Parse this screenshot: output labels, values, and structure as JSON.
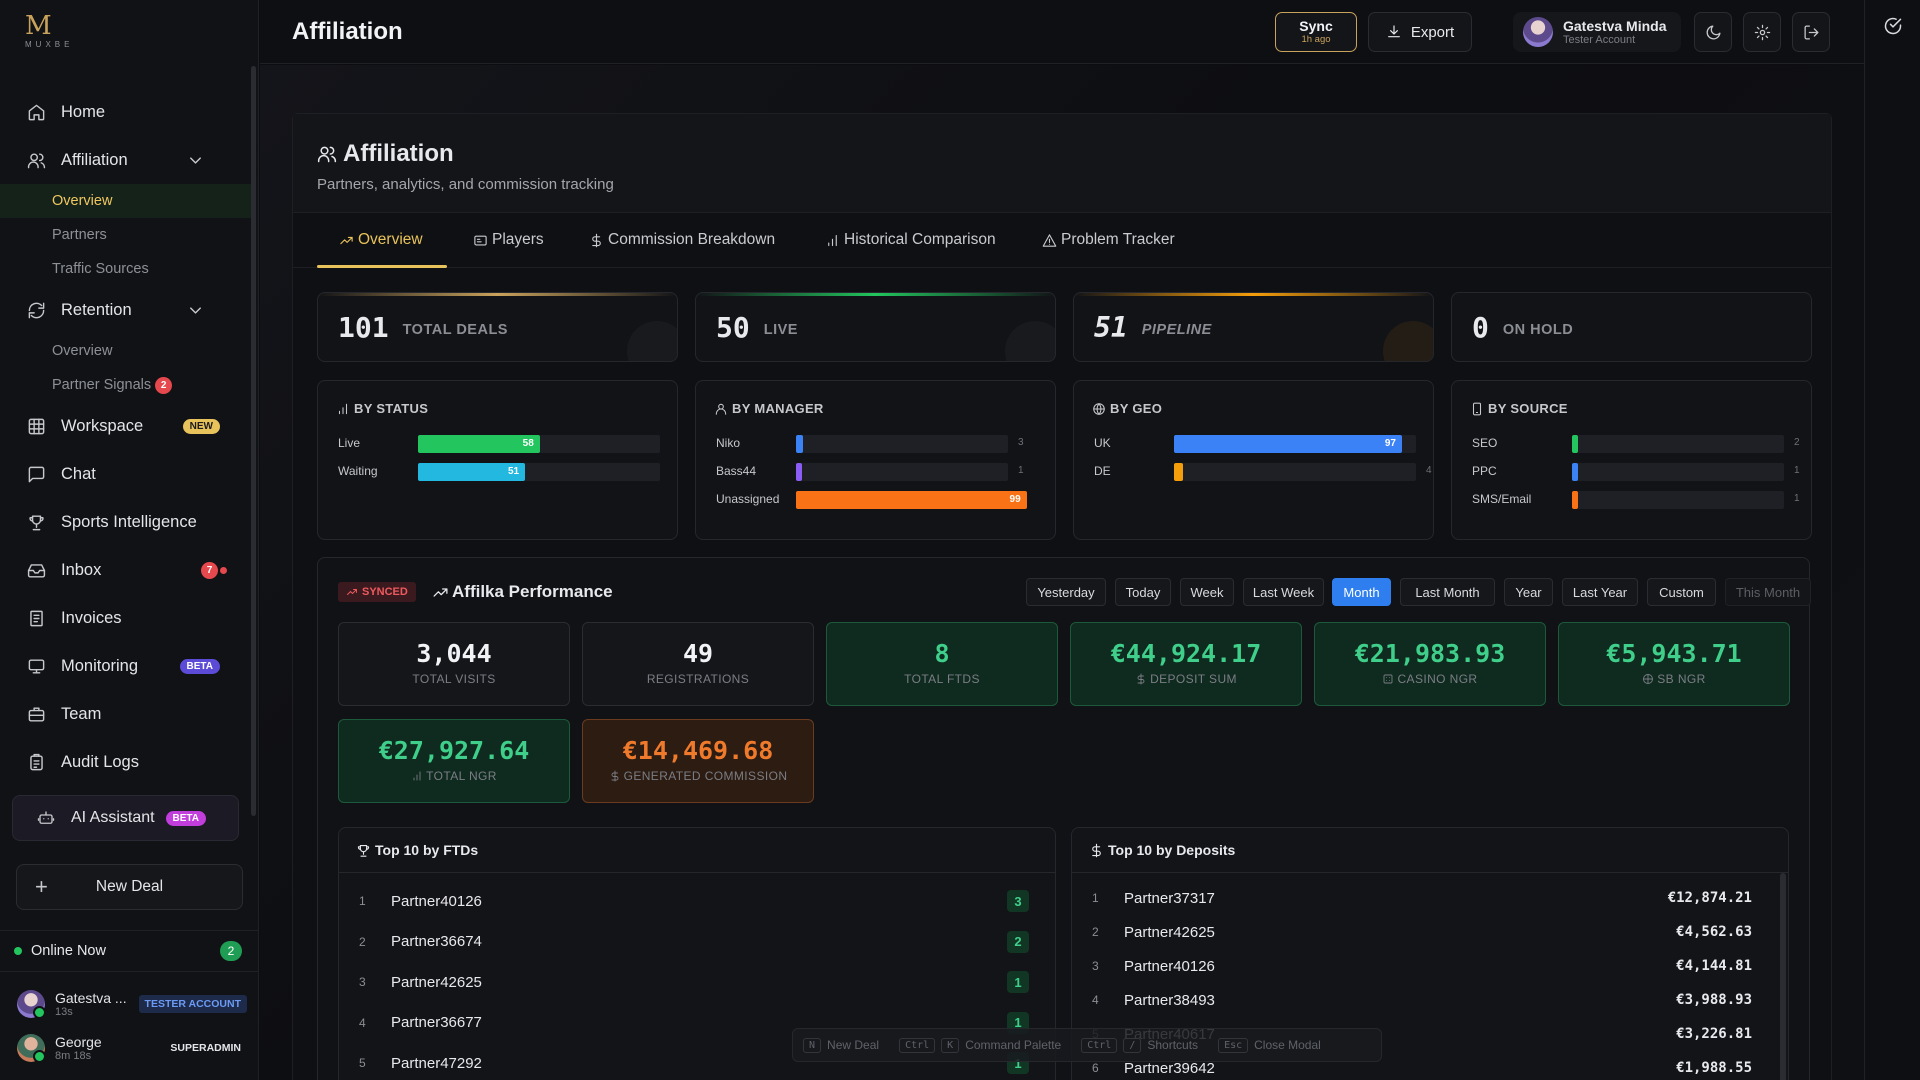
{
  "brand": {
    "mark": "M",
    "wordmark": "MUXBE"
  },
  "nav": {
    "home": "Home",
    "affiliation": "Affiliation",
    "affiliation_sub": [
      "Overview",
      "Partners",
      "Traffic Sources"
    ],
    "retention": "Retention",
    "retention_sub": [
      "Overview",
      "Partner Signals"
    ],
    "partner_signals_badge": "2",
    "workspace": "Workspace",
    "workspace_badge": "NEW",
    "chat": "Chat",
    "sports": "Sports Intelligence",
    "inbox": "Inbox",
    "inbox_badge": "7",
    "invoices": "Invoices",
    "monitoring": "Monitoring",
    "monitoring_badge": "BETA",
    "team": "Team",
    "audit": "Audit Logs",
    "ai": "AI Assistant",
    "ai_badge": "BETA",
    "new_deal": "New Deal"
  },
  "online": {
    "label": "Online Now",
    "count": "2",
    "users": [
      {
        "name": "Gatestva ...",
        "time": "13s",
        "role": "TESTER ACCOUNT"
      },
      {
        "name": "George",
        "time": "8m 18s",
        "role": "SUPERADMIN"
      }
    ]
  },
  "topbar": {
    "title": "Affiliation",
    "sync_label": "Sync",
    "sync_time": "1h ago",
    "export_label": "Export",
    "user_name": "Gatestva Minda",
    "user_role": "Tester Account"
  },
  "header": {
    "title": "Affiliation",
    "subtitle": "Partners, analytics, and commission tracking"
  },
  "tabs": [
    "Overview",
    "Players",
    "Commission Breakdown",
    "Historical Comparison",
    "Problem Tracker"
  ],
  "stats": [
    {
      "value": "101",
      "label": "TOTAL DEALS",
      "color": "#c9a25c"
    },
    {
      "value": "50",
      "label": "LIVE",
      "color": "#22c55e"
    },
    {
      "value": "51",
      "label": "PIPELINE",
      "color": "#f59e0b"
    },
    {
      "value": "0",
      "label": "ON HOLD",
      "color": "#2a2c31"
    }
  ],
  "by_status": {
    "title": "BY STATUS",
    "rows": [
      {
        "label": "Live",
        "value": 58,
        "max": 100,
        "color": "#22c55e"
      },
      {
        "label": "Waiting",
        "value": 51,
        "max": 100,
        "color": "#22b8e0"
      }
    ]
  },
  "by_manager": {
    "title": "BY MANAGER",
    "rows": [
      {
        "label": "Niko",
        "value": 3,
        "max": 100,
        "color": "#3b82f6"
      },
      {
        "label": "Bass44",
        "value": 1,
        "max": 100,
        "color": "#8b5cf6"
      },
      {
        "label": "Unassigned",
        "value": 99,
        "max": 100,
        "color": "#f97316"
      }
    ]
  },
  "by_geo": {
    "title": "BY GEO",
    "rows": [
      {
        "label": "UK",
        "value": 97,
        "max": 100,
        "color": "#3b82f6"
      },
      {
        "label": "DE",
        "value": 4,
        "max": 100,
        "color": "#f59e0b"
      }
    ]
  },
  "by_source": {
    "title": "BY SOURCE",
    "rows": [
      {
        "label": "SEO",
        "value": 2,
        "max": 100,
        "color": "#22c55e"
      },
      {
        "label": "PPC",
        "value": 1,
        "max": 100,
        "color": "#3b82f6"
      },
      {
        "label": "SMS/Email",
        "value": 1,
        "max": 100,
        "color": "#f97316"
      }
    ]
  },
  "performance": {
    "synced": "SYNCED",
    "title": "Affilka Performance",
    "filters": [
      "Yesterday",
      "Today",
      "Week",
      "Last Week",
      "Month",
      "Last Month",
      "Year",
      "Last Year",
      "Custom",
      "This Month"
    ],
    "active_filter": "Month",
    "metrics": [
      {
        "value": "3,044",
        "label": "TOTAL VISITS"
      },
      {
        "value": "49",
        "label": "REGISTRATIONS"
      },
      {
        "value": "8",
        "label": "TOTAL FTDS"
      },
      {
        "value": "€44,924.17",
        "label": "DEPOSIT SUM"
      },
      {
        "value": "€21,983.93",
        "label": "CASINO NGR"
      },
      {
        "value": "€5,943.71",
        "label": "SB NGR"
      },
      {
        "value": "€27,927.64",
        "label": "TOTAL NGR"
      },
      {
        "value": "€14,469.68",
        "label": "GENERATED COMMISSION"
      }
    ]
  },
  "top_ftds": {
    "title": "Top 10 by FTDs",
    "rows": [
      {
        "rank": "1",
        "name": "Partner40126",
        "value": "3"
      },
      {
        "rank": "2",
        "name": "Partner36674",
        "value": "2"
      },
      {
        "rank": "3",
        "name": "Partner42625",
        "value": "1"
      },
      {
        "rank": "4",
        "name": "Partner36677",
        "value": "1"
      },
      {
        "rank": "5",
        "name": "Partner47292",
        "value": "1"
      }
    ]
  },
  "top_deposits": {
    "title": "Top 10 by Deposits",
    "rows": [
      {
        "rank": "1",
        "name": "Partner37317",
        "value": "€12,874.21"
      },
      {
        "rank": "2",
        "name": "Partner42625",
        "value": "€4,562.63"
      },
      {
        "rank": "3",
        "name": "Partner40126",
        "value": "€4,144.81"
      },
      {
        "rank": "4",
        "name": "Partner38493",
        "value": "€3,988.93"
      },
      {
        "rank": "5",
        "name": "Partner40617",
        "value": "€3,226.81"
      },
      {
        "rank": "6",
        "name": "Partner39642",
        "value": "€1,988.55"
      }
    ]
  },
  "hints": [
    {
      "key": "N",
      "label": "New Deal"
    },
    {
      "key": "Ctrl",
      "key2": "K",
      "label": "Command Palette"
    },
    {
      "key": "Ctrl",
      "key2": "/",
      "label": "Shortcuts"
    },
    {
      "key": "Esc",
      "label": "Close Modal"
    }
  ]
}
